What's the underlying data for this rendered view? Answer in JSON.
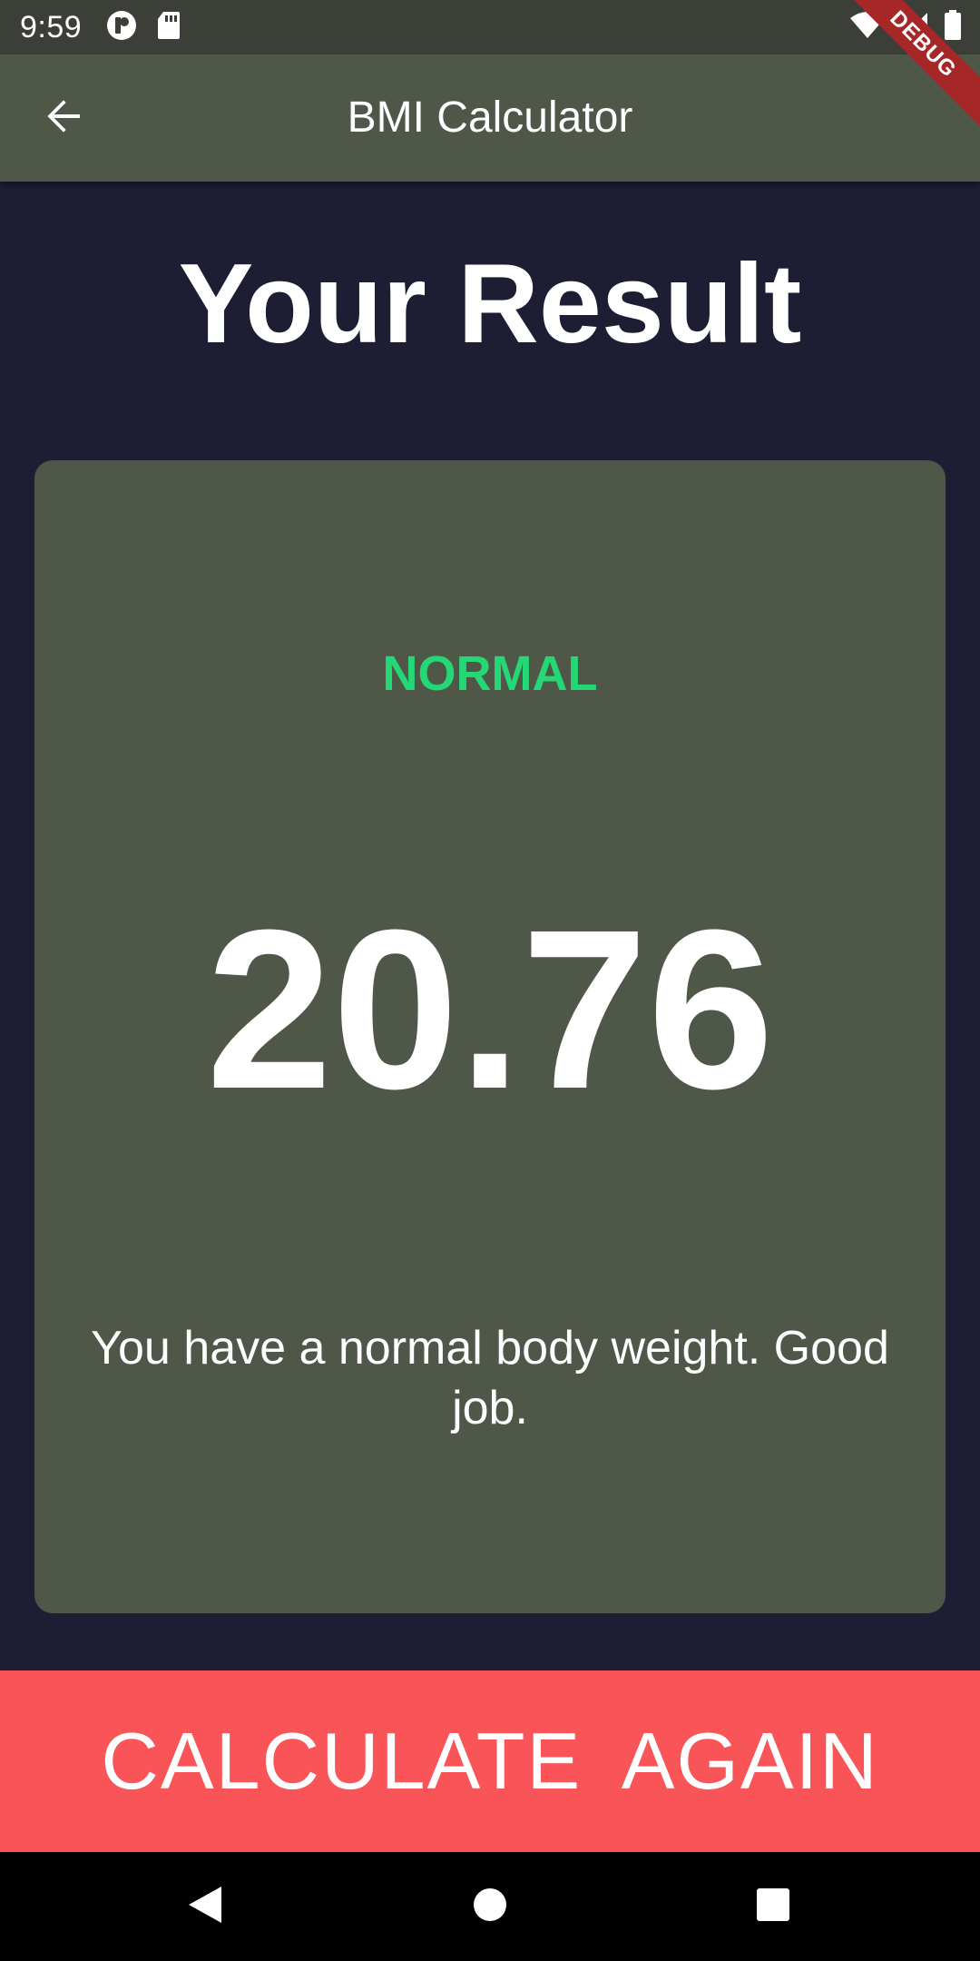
{
  "status_bar": {
    "time": "9:59",
    "icons": [
      "app-notification-icon",
      "sd-card-icon",
      "wifi-icon",
      "signal-icon",
      "battery-icon"
    ]
  },
  "debug_banner": {
    "label": "DEBUG"
  },
  "app_bar": {
    "title": "BMI Calculator",
    "back_icon": "arrow-back-icon"
  },
  "page": {
    "heading": "Your Result"
  },
  "result": {
    "status": "NORMAL",
    "value": "20.76",
    "message": "You have a normal body weight. Good job."
  },
  "bottom_button": {
    "label": "CALCULATE  AGAIN"
  },
  "nav_bar": {
    "icons": [
      "nav-back-icon",
      "nav-home-icon",
      "nav-recents-icon"
    ]
  },
  "colors": {
    "background": "#1d1d33",
    "card": "#4f5848",
    "app_bar": "#4f5848",
    "status_normal": "#24d876",
    "button": "#f95457"
  }
}
